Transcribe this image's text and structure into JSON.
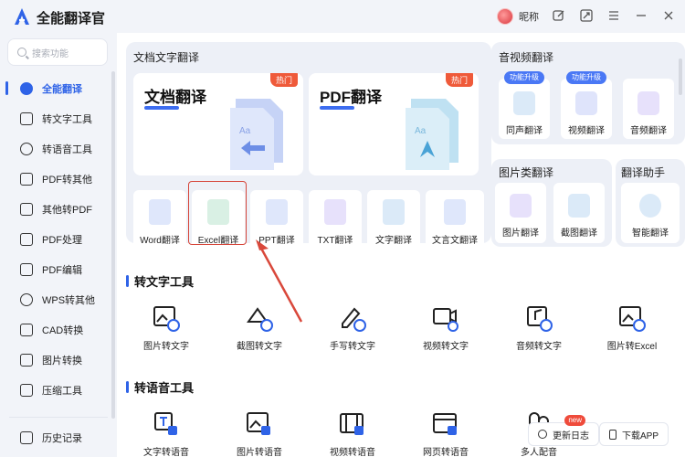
{
  "app": {
    "title": "全能翻译官",
    "nickname": "昵称"
  },
  "titlebar_icons": [
    "edit-icon",
    "fullscreen-icon",
    "menu-icon",
    "minimize-icon",
    "close-icon"
  ],
  "search": {
    "placeholder": "搜索功能"
  },
  "sidebar": {
    "items": [
      {
        "label": "全能翻译",
        "active": true,
        "icon": "translate-icon"
      },
      {
        "label": "转文字工具",
        "icon": "text-tool-icon"
      },
      {
        "label": "转语音工具",
        "icon": "voice-tool-icon"
      },
      {
        "label": "PDF转其他",
        "icon": "pdf-convert-icon"
      },
      {
        "label": "其他转PDF",
        "icon": "to-pdf-icon"
      },
      {
        "label": "PDF处理",
        "icon": "pdf-process-icon"
      },
      {
        "label": "PDF编辑",
        "icon": "pdf-edit-icon"
      },
      {
        "label": "WPS转其他",
        "icon": "wps-icon"
      },
      {
        "label": "CAD转换",
        "icon": "cad-icon"
      },
      {
        "label": "图片转换",
        "icon": "image-convert-icon"
      },
      {
        "label": "压缩工具",
        "icon": "compress-icon"
      }
    ],
    "history": "历史记录"
  },
  "doc_section": {
    "title": "文档文字翻译",
    "big_cards": [
      {
        "title": "文档翻译",
        "badge": "热门"
      },
      {
        "title": "PDF翻译",
        "badge": "热门"
      }
    ],
    "small_cards": [
      {
        "label": "Word翻译",
        "color": "#3f6ee8"
      },
      {
        "label": "Excel翻译",
        "color": "#2fa36b"
      },
      {
        "label": "PPT翻译",
        "color": "#e8703f"
      },
      {
        "label": "TXT翻译",
        "color": "#7b5cf0"
      },
      {
        "label": "文字翻译",
        "color": "#3a8fe8"
      },
      {
        "label": "文言文翻译",
        "color": "#e8a33f"
      }
    ]
  },
  "av_section": {
    "title": "音视频翻译",
    "cards": [
      {
        "label": "同声翻译",
        "tag": "功能升级"
      },
      {
        "label": "视频翻译",
        "tag": "功能升级"
      },
      {
        "label": "音频翻译",
        "tag": ""
      }
    ]
  },
  "img_section": {
    "title": "图片类翻译",
    "cards": [
      {
        "label": "图片翻译"
      },
      {
        "label": "截图翻译"
      }
    ]
  },
  "help_section": {
    "title": "翻译助手",
    "cards": [
      {
        "label": "智能翻译"
      }
    ]
  },
  "text_tools": {
    "heading": "转文字工具",
    "items": [
      "图片转文字",
      "截图转文字",
      "手写转文字",
      "视频转文字",
      "音频转文字",
      "图片转Excel"
    ]
  },
  "voice_tools": {
    "heading": "转语音工具",
    "items": [
      "文字转语音",
      "图片转语音",
      "视频转语音",
      "网页转语音",
      "多人配音"
    ]
  },
  "floating": {
    "changelog": "更新日志",
    "new_badge": "new",
    "download": "下载APP"
  }
}
